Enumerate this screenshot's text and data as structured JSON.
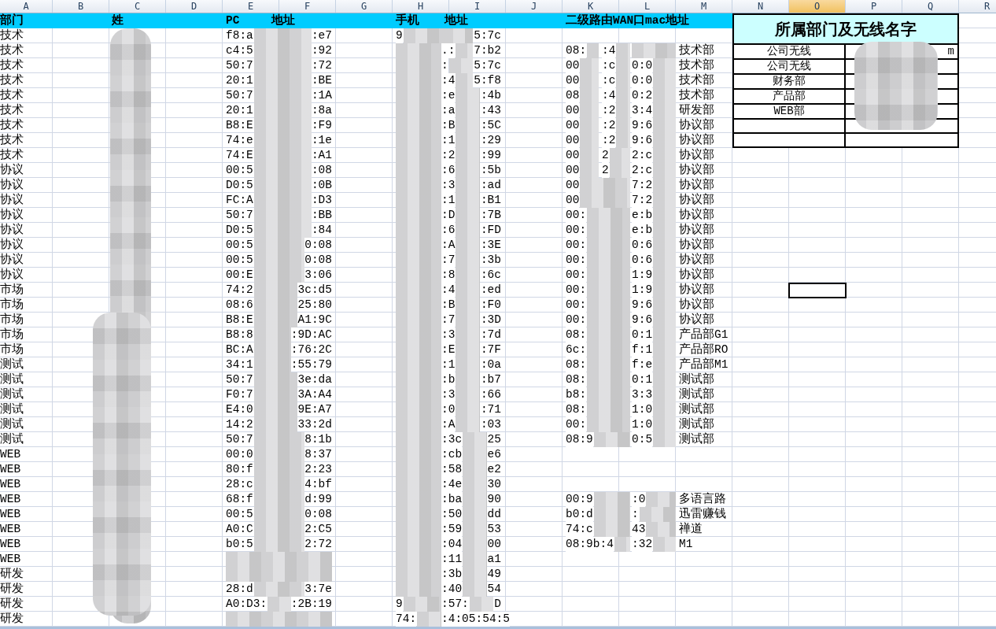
{
  "columns": [
    {
      "label": "A",
      "selected": false
    },
    {
      "label": "B",
      "selected": false
    },
    {
      "label": "C",
      "selected": false
    },
    {
      "label": "D",
      "selected": false
    },
    {
      "label": "E",
      "selected": false
    },
    {
      "label": "F",
      "selected": false
    },
    {
      "label": "G",
      "selected": false
    },
    {
      "label": "H",
      "selected": false
    },
    {
      "label": "I",
      "selected": false
    },
    {
      "label": "J",
      "selected": false
    },
    {
      "label": "K",
      "selected": false
    },
    {
      "label": "L",
      "selected": false
    },
    {
      "label": "M",
      "selected": false
    },
    {
      "label": "N",
      "selected": false
    },
    {
      "label": "O",
      "selected": true
    },
    {
      "label": "P",
      "selected": false
    },
    {
      "label": "Q",
      "selected": false
    },
    {
      "label": "R",
      "selected": false
    }
  ],
  "header_row": {
    "department": "部门",
    "name": "姓",
    "pc_mac_start": "PC",
    "pc_mac_end": "地址",
    "phone_mac_start": "手机",
    "phone_mac_end": "地址",
    "router_wan_mac": "二级路由WAN口mac地址"
  },
  "rows": [
    {
      "department": "技术",
      "pc": {
        "start": "f8:a",
        "end": ":e7"
      },
      "phone": {
        "start": "9",
        "end": "5:7c"
      }
    },
    {
      "department": "技术",
      "pc": {
        "start": "c4:5",
        "end": ":92"
      },
      "phone": {
        "mid": ".:",
        "end": "7:b2"
      },
      "wan": {
        "start": "08:",
        "mid": ":4",
        "label": "技术部"
      }
    },
    {
      "department": "技术",
      "pc": {
        "start": "50:7",
        "end": ":72"
      },
      "phone": {
        "mid": ":",
        "end": "5:7c"
      },
      "wan": {
        "start": "00",
        "mid": ":c",
        "mid2": "0:0",
        "label": "技术部"
      }
    },
    {
      "department": "技术",
      "pc": {
        "start": "20:1",
        "end": ":BE"
      },
      "phone": {
        "mid": ":4",
        "end": "5:f8"
      },
      "wan": {
        "start": "00",
        "mid": ":c",
        "mid2": "0:0",
        "label": "技术部"
      }
    },
    {
      "department": "技术",
      "pc": {
        "start": "50:7",
        "end": ":1A"
      },
      "phone": {
        "mid": ":e",
        "end": ":4b"
      },
      "wan": {
        "start": "08",
        "mid": ":4",
        "mid2": "0:2",
        "label": "技术部"
      }
    },
    {
      "department": "技术",
      "pc": {
        "start": "20:1",
        "end": ":8a"
      },
      "phone": {
        "mid": ":a",
        "end": ":43"
      },
      "wan": {
        "start": "00",
        "mid": ":2",
        "mid2": "3:4",
        "label": "研发部"
      }
    },
    {
      "department": "技术",
      "pc": {
        "start": "B8:E",
        "end": ":F9"
      },
      "phone": {
        "mid": ":B",
        "end": ":5C"
      },
      "wan": {
        "start": "00",
        "mid": ":2",
        "mid2": "9:6",
        "label": "协议部"
      }
    },
    {
      "department": "技术",
      "pc": {
        "start": "74:e",
        "end": ":1e"
      },
      "phone": {
        "mid": ":1",
        "end": ":29"
      },
      "wan": {
        "start": "00",
        "mid": ":2",
        "mid2": "9:6",
        "label": "协议部"
      }
    },
    {
      "department": "技术",
      "pc": {
        "start": "74:E",
        "end": ":A1"
      },
      "phone": {
        "mid": ":2",
        "end": ":99"
      },
      "wan": {
        "start": "00",
        "mid": "2",
        "mid2": "2:c",
        "label": "协议部"
      }
    },
    {
      "department": "协议",
      "pc": {
        "start": "00:5",
        "end": ":08"
      },
      "phone": {
        "mid": ":6",
        "end": ":5b"
      },
      "wan": {
        "start": "00",
        "mid": "2",
        "mid2": "2:c",
        "label": "协议部"
      }
    },
    {
      "department": "协议",
      "pc": {
        "start": "D0:5",
        "end": ":0B"
      },
      "phone": {
        "mid": ":3",
        "end": ":ad"
      },
      "wan": {
        "start": "00",
        "mid2": "7:2",
        "label": "协议部"
      }
    },
    {
      "department": "协议",
      "pc": {
        "start": "FC:A",
        "end": ":D3"
      },
      "phone": {
        "mid": ":1",
        "end": ":B1"
      },
      "wan": {
        "start": "00",
        "mid2": "7:2",
        "label": "协议部"
      }
    },
    {
      "department": "协议",
      "pc": {
        "start": "50:7",
        "end": ":BB"
      },
      "phone": {
        "mid": ":D",
        "end": ":7B"
      },
      "wan": {
        "start": "00:",
        "mid2": "e:b",
        "label": "协议部"
      }
    },
    {
      "department": "协议",
      "pc": {
        "start": "D0:5",
        "end": ":84"
      },
      "phone": {
        "mid": ":6",
        "end": ":FD"
      },
      "wan": {
        "start": "00:",
        "mid2": "e:b",
        "label": "协议部"
      }
    },
    {
      "department": "协议",
      "pc": {
        "start": "00:5",
        "end": "0:08"
      },
      "phone": {
        "mid": ":A",
        "end": ":3E"
      },
      "wan": {
        "start": "00:",
        "mid2": "0:6",
        "label": "协议部"
      }
    },
    {
      "department": "协议",
      "pc": {
        "start": "00:5",
        "end": "0:08"
      },
      "phone": {
        "mid": ":7",
        "end": ":3b"
      },
      "wan": {
        "start": "00:",
        "mid2": "0:6",
        "label": "协议部"
      }
    },
    {
      "department": "协议",
      "pc": {
        "start": "00:E",
        "end": "3:06"
      },
      "phone": {
        "mid": ":8",
        "end": ":6c"
      },
      "wan": {
        "start": "00:",
        "mid2": "1:9",
        "label": "协议部"
      }
    },
    {
      "department": "市场",
      "pc": {
        "start": "74:2",
        "end": "3c:d5"
      },
      "phone": {
        "mid": ":4",
        "end": ":ed"
      },
      "wan": {
        "start": "00:",
        "mid2": "1:9",
        "label": "协议部"
      }
    },
    {
      "department": "市场",
      "pc": {
        "start": "08:6",
        "end": "25:80"
      },
      "phone": {
        "mid": ":B",
        "end": ":F0"
      },
      "wan": {
        "start": "00:",
        "mid2": "9:6",
        "label": "协议部"
      }
    },
    {
      "department": "市场",
      "pc": {
        "start": "B8:E",
        "end": "A1:9C"
      },
      "phone": {
        "mid": ":7",
        "end": ":3D"
      },
      "wan": {
        "start": "00:",
        "mid2": "9:6",
        "label": "协议部"
      }
    },
    {
      "department": "市场",
      "pc": {
        "start": "B8:8",
        "end": ":9D:AC"
      },
      "phone": {
        "mid": ":3",
        "end": ":7d"
      },
      "wan": {
        "start": "08:",
        "mid2": "0:1",
        "label": "产品部G1"
      }
    },
    {
      "department": "市场",
      "pc": {
        "start": "BC:A",
        "end": ":76:2C"
      },
      "phone": {
        "mid": ":E",
        "end": ":7F"
      },
      "wan": {
        "start": "6c:",
        "mid2": "f:1",
        "label": "产品部RO"
      }
    },
    {
      "department": "测试",
      "pc": {
        "start": "34:1",
        "end": ":55:79"
      },
      "phone": {
        "mid": ":1",
        "end": ":0a"
      },
      "wan": {
        "start": "08:",
        "mid2": "f:e",
        "label": "产品部M1"
      }
    },
    {
      "department": "测试",
      "pc": {
        "start": "50:7",
        "end": "3e:da"
      },
      "phone": {
        "mid": ":b",
        "end": ":b7"
      },
      "wan": {
        "start": "08:",
        "mid2": "0:1",
        "label": "测试部"
      }
    },
    {
      "department": "测试",
      "pc": {
        "start": "F0:7",
        "end": "3A:A4"
      },
      "phone": {
        "mid": ":3",
        "end": ":66"
      },
      "wan": {
        "start": "b8:",
        "mid2": "3:3",
        "label": "测试部"
      }
    },
    {
      "department": "测试",
      "pc": {
        "start": "E4:0",
        "end": "9E:A7"
      },
      "phone": {
        "mid": ":0",
        "end": ":71"
      },
      "wan": {
        "start": "08:",
        "mid2": "1:0",
        "label": "测试部"
      }
    },
    {
      "department": "测试",
      "pc": {
        "start": "14:2",
        "end": "33:2d"
      },
      "phone": {
        "mid": ":A",
        "end": ":03"
      },
      "wan": {
        "start": "00:",
        "mid2": "1:0",
        "label": "测试部"
      }
    },
    {
      "department": "测试",
      "pc": {
        "start": "50:7",
        "end": "8:1b"
      },
      "phone": {
        "mid": ":3c",
        "end": "25"
      },
      "wan": {
        "start": "08:9",
        "mid2": "0:5",
        "label": "测试部"
      }
    },
    {
      "department": "WEB",
      "pc": {
        "start": "00:0",
        "end": "8:37"
      },
      "phone": {
        "mid": ":cb",
        "end": "e6"
      }
    },
    {
      "department": "WEB",
      "pc": {
        "start": "80:f",
        "end": "2:23"
      },
      "phone": {
        "mid": ":58",
        "end": "e2"
      }
    },
    {
      "department": "WEB",
      "pc": {
        "start": "28:c",
        "end": "4:bf"
      },
      "phone": {
        "mid": ":4e",
        "end": "30"
      }
    },
    {
      "department": "WEB",
      "pc": {
        "start": "68:f",
        "end": "d:99"
      },
      "phone": {
        "mid": ":ba",
        "end": "90"
      },
      "wan": {
        "start": "00:9",
        "mid2": ":0",
        "label": "多语言路"
      }
    },
    {
      "department": "WEB",
      "pc": {
        "start": "00:5",
        "end": "0:08"
      },
      "phone": {
        "mid": ":50",
        "end": "dd"
      },
      "wan": {
        "start": "b0:d",
        "mid2": ":",
        "label": "迅雷赚钱"
      }
    },
    {
      "department": "WEB",
      "pc": {
        "start": "A0:C",
        "end": "2:C5"
      },
      "phone": {
        "mid": ":59",
        "end": "53"
      },
      "wan": {
        "start": "74:c",
        "mid2": "43",
        "label": "禅道"
      }
    },
    {
      "department": "WEB",
      "pc": {
        "start": "b0:5",
        "end": "2:72"
      },
      "phone": {
        "mid": ":04",
        "end": "00"
      },
      "wan": {
        "start": "08:9b:4",
        "mid2": ":32",
        "label": "M1"
      }
    },
    {
      "department": "WEB",
      "phone": {
        "mid": ":11",
        "end": "a1"
      }
    },
    {
      "department": "研发",
      "phone": {
        "mid": ":3b",
        "end": "49"
      }
    },
    {
      "department": "研发",
      "pc": {
        "start": "28:d",
        "end": "3:7e"
      },
      "phone": {
        "mid": ":40",
        "end": "54"
      }
    },
    {
      "department": "研发",
      "pc": {
        "start": "A0:D3:",
        "end": ":2B:19"
      },
      "phone": {
        "start": "9",
        "mid": ":57:",
        "end": "D"
      }
    },
    {
      "department": "研发",
      "phone": {
        "start": "74:",
        "mid": ":4:05:54:5"
      }
    }
  ],
  "wireless_table": {
    "title": "所属部门及无线名字",
    "rows": [
      {
        "department": "公司无线",
        "wireless_name": "m"
      },
      {
        "department": "公司无线"
      },
      {
        "department": "财务部"
      },
      {
        "department": "产品部"
      },
      {
        "department": "WEB部"
      }
    ]
  }
}
